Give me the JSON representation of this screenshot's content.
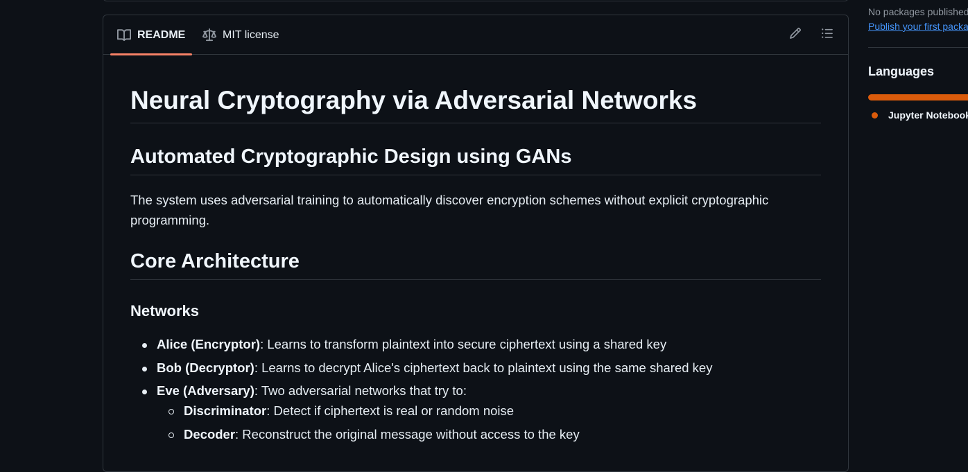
{
  "tabs": {
    "readme_label": "README",
    "license_label": "MIT license"
  },
  "readme": {
    "title": "Neural Cryptography via Adversarial Networks",
    "subtitle": "Automated Cryptographic Design using GANs",
    "intro": "The system uses adversarial training to automatically discover encryption schemes without explicit cryptographic programming.",
    "section_heading": "Core Architecture",
    "subsection_heading": "Networks",
    "items": [
      {
        "name": "Alice (Encryptor)",
        "text": ": Learns to transform plaintext into secure ciphertext using a shared key"
      },
      {
        "name": "Bob (Decryptor)",
        "text": ": Learns to decrypt Alice's ciphertext back to plaintext using the same shared key"
      },
      {
        "name": "Eve (Adversary)",
        "text": ": Two adversarial networks that try to:"
      }
    ],
    "subitems": [
      {
        "name": "Discriminator",
        "text": ": Detect if ciphertext is real or random noise"
      },
      {
        "name": "Decoder",
        "text": ": Reconstruct the original message without access to the key"
      }
    ]
  },
  "sidebar": {
    "packages_text": "No packages published",
    "publish_link": "Publish your first package",
    "languages_title": "Languages",
    "languages": [
      {
        "name": "Jupyter Notebook",
        "percent": 100.0,
        "color": "#da5b0b"
      }
    ]
  },
  "colors": {
    "background": "#0d1117",
    "border": "#30363d",
    "accent_underline": "#f78166",
    "link": "#4493f8",
    "jupyter": "#da5b0b"
  }
}
